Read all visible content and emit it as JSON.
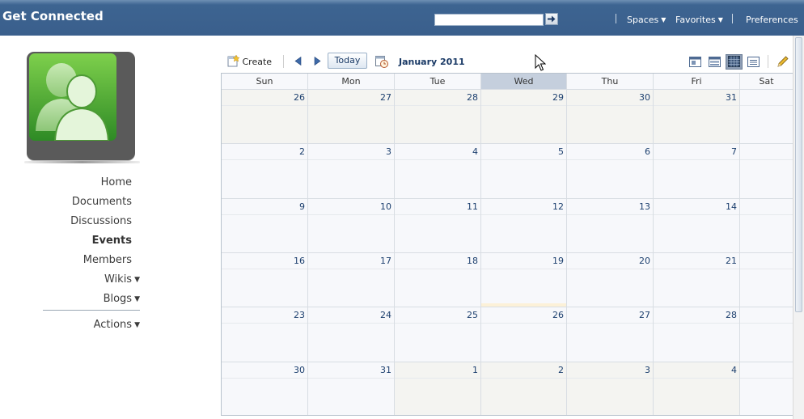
{
  "header": {
    "title": "Get Connected",
    "search": {
      "value": "",
      "placeholder": ""
    },
    "nav": [
      {
        "label": "Spaces",
        "has_dropdown": true
      },
      {
        "label": "Favorites",
        "has_dropdown": true
      },
      {
        "label": "Preferences",
        "has_dropdown": false
      }
    ]
  },
  "sidebar": {
    "items": [
      {
        "label": "Home",
        "active": false
      },
      {
        "label": "Documents",
        "active": false
      },
      {
        "label": "Discussions",
        "active": false
      },
      {
        "label": "Events",
        "active": true
      },
      {
        "label": "Members",
        "active": false
      },
      {
        "label": "Wikis",
        "active": false,
        "has_dropdown": true
      },
      {
        "label": "Blogs",
        "active": false,
        "has_dropdown": true
      }
    ],
    "actions": {
      "label": "Actions",
      "has_dropdown": true
    }
  },
  "toolbar": {
    "create_label": "Create",
    "today_label": "Today",
    "month_label": "January 2011",
    "views": [
      "day-view-icon",
      "week-view-icon",
      "month-view-icon",
      "list-view-icon"
    ],
    "active_view": "month-view-icon"
  },
  "calendar": {
    "day_headers": [
      "Sun",
      "Mon",
      "Tue",
      "Wed",
      "Thu",
      "Fri",
      "Sat"
    ],
    "today_column": 3,
    "weeks": [
      [
        "26",
        "27",
        "28",
        "29",
        "30",
        "31",
        ""
      ],
      [
        "2",
        "3",
        "4",
        "5",
        "6",
        "7",
        ""
      ],
      [
        "9",
        "10",
        "11",
        "12",
        "13",
        "14",
        ""
      ],
      [
        "16",
        "17",
        "18",
        "19",
        "20",
        "21",
        ""
      ],
      [
        "23",
        "24",
        "25",
        "26",
        "27",
        "28",
        ""
      ],
      [
        "30",
        "31",
        "1",
        "2",
        "3",
        "4",
        ""
      ]
    ],
    "other_month_cells": [
      [
        0,
        0
      ],
      [
        0,
        1
      ],
      [
        0,
        2
      ],
      [
        0,
        3
      ],
      [
        0,
        4
      ],
      [
        0,
        5
      ],
      [
        5,
        2
      ],
      [
        5,
        3
      ],
      [
        5,
        4
      ],
      [
        5,
        5
      ]
    ],
    "highlight_cell": [
      3,
      3
    ]
  },
  "colors": {
    "header_bg": "#3a5f8c",
    "link_blue": "#1c3f6e",
    "today_header": "#c5cfdd",
    "logo_green": "#5cb83a"
  }
}
